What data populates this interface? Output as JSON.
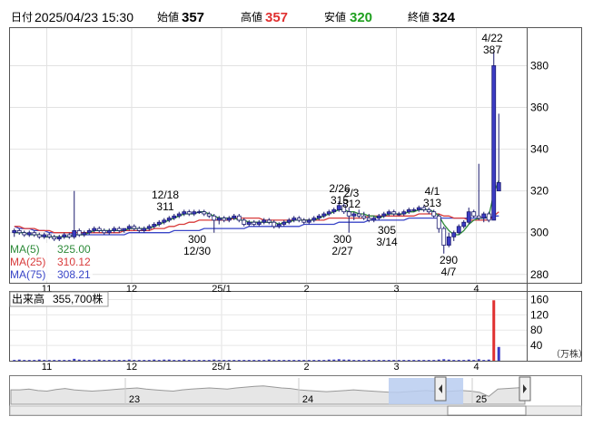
{
  "header": {
    "date_label": "日付",
    "date_value": "2025/04/23 15:30",
    "open_label": "始値",
    "open_value": "357",
    "high_label": "高値",
    "high_value": "357",
    "low_label": "安値",
    "low_value": "320",
    "close_label": "終値",
    "close_value": "324"
  },
  "volume_header": {
    "label": "出来高",
    "value": "355,700株"
  },
  "volume_unit": "（万株）",
  "colors": {
    "up_candle": "#3b3bc4",
    "down_candle": "#ffffff",
    "ma5": "#2e8b3a",
    "ma25": "#d83b3b",
    "ma75": "#3a46c8",
    "high_text": "#e03030",
    "low_text": "#20a020",
    "volume_bar": "#3b3bc4",
    "volume_spike": "#e03030",
    "navigator_highlight": "#b8cdf0"
  },
  "chart_data": [
    {
      "type": "candlestick",
      "title": "",
      "y_ticks": [
        280,
        300,
        320,
        340,
        360,
        380
      ],
      "ylim": [
        276,
        398
      ],
      "x_month_ticks": [
        "11",
        "12",
        "25/1",
        "2",
        "3",
        "4"
      ],
      "ma_legend": [
        {
          "name": "MA(5)",
          "value": "325.00"
        },
        {
          "name": "MA(25)",
          "value": "310.12"
        },
        {
          "name": "MA(75)",
          "value": "308.21"
        }
      ],
      "annotations": [
        {
          "date": "12/18",
          "value": "311",
          "kind": "high"
        },
        {
          "date": "12/30",
          "value": "300",
          "kind": "low"
        },
        {
          "date": "2/26",
          "value": "315",
          "kind": "high"
        },
        {
          "date": "2/3",
          "value": "312",
          "kind": "high"
        },
        {
          "date": "2/27",
          "value": "300",
          "kind": "low"
        },
        {
          "date": "3/14",
          "value": "305",
          "kind": "low"
        },
        {
          "date": "4/1",
          "value": "313",
          "kind": "high"
        },
        {
          "date": "4/7",
          "value": "290",
          "kind": "low"
        },
        {
          "date": "4/22",
          "value": "387",
          "kind": "high"
        }
      ],
      "candles": [
        [
          300,
          302,
          298,
          301
        ],
        [
          301,
          302,
          299,
          300
        ],
        [
          300,
          301,
          298,
          299
        ],
        [
          299,
          301,
          298,
          300
        ],
        [
          300,
          301,
          298,
          299
        ],
        [
          299,
          300,
          297,
          298
        ],
        [
          298,
          300,
          297,
          299
        ],
        [
          299,
          300,
          297,
          298
        ],
        [
          298,
          299,
          296,
          297
        ],
        [
          297,
          299,
          296,
          298
        ],
        [
          298,
          300,
          297,
          299
        ],
        [
          299,
          300,
          297,
          298
        ],
        [
          298,
          320,
          297,
          301
        ],
        [
          301,
          302,
          298,
          299
        ],
        [
          299,
          301,
          298,
          300
        ],
        [
          300,
          302,
          299,
          301
        ],
        [
          301,
          303,
          300,
          302
        ],
        [
          302,
          303,
          300,
          301
        ],
        [
          301,
          302,
          299,
          300
        ],
        [
          300,
          302,
          299,
          301
        ],
        [
          301,
          303,
          300,
          302
        ],
        [
          302,
          303,
          300,
          301
        ],
        [
          301,
          302,
          300,
          302
        ],
        [
          302,
          304,
          301,
          303
        ],
        [
          303,
          304,
          301,
          302
        ],
        [
          302,
          303,
          300,
          301
        ],
        [
          301,
          303,
          300,
          302
        ],
        [
          302,
          304,
          301,
          303
        ],
        [
          303,
          305,
          302,
          304
        ],
        [
          304,
          306,
          303,
          305
        ],
        [
          305,
          307,
          304,
          306
        ],
        [
          306,
          308,
          305,
          307
        ],
        [
          307,
          309,
          306,
          308
        ],
        [
          308,
          310,
          307,
          309
        ],
        [
          309,
          311,
          308,
          310
        ],
        [
          310,
          311,
          308,
          309
        ],
        [
          309,
          311,
          308,
          310
        ],
        [
          310,
          311,
          309,
          310
        ],
        [
          310,
          311,
          308,
          309
        ],
        [
          309,
          310,
          307,
          308
        ],
        [
          308,
          309,
          300,
          306
        ],
        [
          306,
          308,
          304,
          307
        ],
        [
          307,
          308,
          305,
          306
        ],
        [
          306,
          308,
          305,
          307
        ],
        [
          307,
          309,
          306,
          308
        ],
        [
          308,
          309,
          305,
          306
        ],
        [
          306,
          307,
          303,
          304
        ],
        [
          304,
          306,
          303,
          305
        ],
        [
          305,
          306,
          303,
          304
        ],
        [
          304,
          306,
          303,
          305
        ],
        [
          305,
          307,
          304,
          306
        ],
        [
          306,
          307,
          304,
          305
        ],
        [
          305,
          306,
          302,
          303
        ],
        [
          303,
          305,
          302,
          304
        ],
        [
          304,
          306,
          303,
          305
        ],
        [
          305,
          307,
          304,
          306
        ],
        [
          306,
          308,
          305,
          307
        ],
        [
          307,
          308,
          305,
          306
        ],
        [
          306,
          307,
          304,
          305
        ],
        [
          305,
          307,
          304,
          306
        ],
        [
          306,
          308,
          305,
          307
        ],
        [
          307,
          309,
          306,
          308
        ],
        [
          308,
          310,
          307,
          309
        ],
        [
          309,
          311,
          308,
          310
        ],
        [
          310,
          312,
          309,
          311
        ],
        [
          311,
          315,
          310,
          313
        ],
        [
          313,
          314,
          309,
          310
        ],
        [
          310,
          312,
          300,
          308
        ],
        [
          308,
          310,
          306,
          309
        ],
        [
          309,
          311,
          307,
          308
        ],
        [
          308,
          310,
          306,
          307
        ],
        [
          307,
          309,
          305,
          306
        ],
        [
          306,
          308,
          305,
          307
        ],
        [
          307,
          309,
          306,
          308
        ],
        [
          308,
          310,
          307,
          309
        ],
        [
          309,
          311,
          308,
          310
        ],
        [
          310,
          311,
          308,
          309
        ],
        [
          309,
          310,
          308,
          309
        ],
        [
          309,
          311,
          308,
          310
        ],
        [
          310,
          312,
          309,
          311
        ],
        [
          311,
          312,
          310,
          311
        ],
        [
          311,
          313,
          310,
          312
        ],
        [
          312,
          313,
          310,
          311
        ],
        [
          311,
          312,
          309,
          310
        ],
        [
          310,
          311,
          307,
          308
        ],
        [
          308,
          309,
          300,
          302
        ],
        [
          302,
          303,
          290,
          294
        ],
        [
          294,
          300,
          293,
          298
        ],
        [
          298,
          301,
          296,
          300
        ],
        [
          300,
          304,
          299,
          303
        ],
        [
          303,
          306,
          302,
          305
        ],
        [
          305,
          312,
          304,
          310
        ],
        [
          310,
          311,
          307,
          308
        ],
        [
          308,
          333,
          306,
          307
        ],
        [
          307,
          310,
          305,
          309
        ],
        [
          309,
          310,
          305,
          306
        ],
        [
          306,
          387,
          306,
          380
        ],
        [
          320,
          357,
          320,
          324
        ]
      ],
      "ma5": [
        300,
        300,
        300,
        299,
        299,
        299,
        298,
        298,
        298,
        298,
        298,
        298,
        299,
        299,
        299,
        300,
        301,
        301,
        301,
        301,
        301,
        301,
        301,
        302,
        302,
        302,
        302,
        302,
        303,
        304,
        305,
        306,
        307,
        308,
        309,
        309,
        309,
        310,
        310,
        309,
        308,
        307,
        307,
        307,
        307,
        306,
        306,
        305,
        305,
        305,
        305,
        305,
        305,
        304,
        305,
        305,
        306,
        306,
        306,
        306,
        306,
        307,
        308,
        309,
        310,
        311,
        311,
        310,
        310,
        309,
        309,
        308,
        308,
        307,
        308,
        309,
        309,
        309,
        309,
        310,
        310,
        311,
        311,
        311,
        310,
        308,
        304,
        301,
        299,
        299,
        301,
        304,
        306,
        307,
        307,
        308,
        319,
        325
      ],
      "ma25": [
        303,
        303,
        302,
        302,
        302,
        301,
        301,
        301,
        300,
        300,
        300,
        300,
        300,
        300,
        300,
        300,
        300,
        300,
        300,
        300,
        300,
        300,
        301,
        301,
        301,
        301,
        301,
        301,
        302,
        302,
        302,
        303,
        303,
        304,
        304,
        305,
        305,
        306,
        306,
        306,
        306,
        306,
        306,
        306,
        307,
        307,
        307,
        307,
        307,
        307,
        306,
        306,
        306,
        306,
        306,
        306,
        306,
        306,
        306,
        306,
        306,
        306,
        306,
        307,
        307,
        307,
        307,
        307,
        307,
        307,
        307,
        308,
        308,
        308,
        308,
        308,
        308,
        308,
        308,
        308,
        308,
        309,
        309,
        309,
        309,
        309,
        308,
        308,
        307,
        307,
        307,
        306,
        306,
        306,
        306,
        306,
        308,
        310
      ],
      "ma75": [
        303,
        302,
        302,
        302,
        301,
        301,
        301,
        300,
        300,
        300,
        300,
        300,
        299,
        299,
        299,
        299,
        299,
        299,
        299,
        299,
        299,
        299,
        299,
        300,
        300,
        300,
        300,
        300,
        300,
        300,
        300,
        300,
        301,
        301,
        301,
        301,
        301,
        301,
        302,
        302,
        302,
        302,
        302,
        302,
        302,
        302,
        302,
        303,
        303,
        303,
        303,
        303,
        303,
        303,
        303,
        303,
        303,
        303,
        304,
        304,
        304,
        304,
        304,
        304,
        304,
        305,
        305,
        305,
        305,
        305,
        305,
        306,
        306,
        306,
        306,
        306,
        306,
        306,
        306,
        307,
        307,
        307,
        307,
        307,
        307,
        307,
        307,
        307,
        307,
        307,
        307,
        307,
        307,
        307,
        307,
        307,
        308,
        308
      ]
    },
    {
      "type": "bar",
      "title": "",
      "y_ticks": [
        40,
        80,
        120,
        160
      ],
      "ylim": [
        0,
        180
      ],
      "unit": "万株",
      "values": [
        2,
        3,
        2,
        2,
        2,
        3,
        2,
        2,
        2,
        2,
        2,
        2,
        5,
        3,
        2,
        2,
        2,
        3,
        2,
        2,
        2,
        2,
        2,
        3,
        2,
        2,
        2,
        2,
        3,
        2,
        3,
        3,
        2,
        2,
        3,
        2,
        2,
        2,
        2,
        2,
        3,
        2,
        2,
        2,
        2,
        2,
        2,
        2,
        2,
        2,
        2,
        3,
        2,
        2,
        2,
        2,
        2,
        2,
        2,
        2,
        2,
        2,
        2,
        3,
        3,
        4,
        3,
        3,
        2,
        2,
        2,
        2,
        2,
        2,
        2,
        2,
        2,
        2,
        2,
        2,
        2,
        2,
        2,
        2,
        2,
        3,
        4,
        3,
        2,
        2,
        2,
        3,
        2,
        4,
        2,
        3,
        158,
        36
      ],
      "spike_indices": [
        96
      ]
    },
    {
      "type": "area",
      "title": "",
      "year_labels": [
        "23",
        "24",
        "25"
      ],
      "values": [
        0.55,
        0.55,
        0.58,
        0.52,
        0.5,
        0.56,
        0.6,
        0.55,
        0.52,
        0.5,
        0.52,
        0.55,
        0.58,
        0.6,
        0.62,
        0.58,
        0.55,
        0.52,
        0.5,
        0.55,
        0.58,
        0.6,
        0.62,
        0.6,
        0.58,
        0.62,
        0.65,
        0.68,
        0.7,
        0.66,
        0.62,
        0.6,
        0.55,
        0.52,
        0.5,
        0.48,
        0.5,
        0.52,
        0.55,
        0.52,
        0.5,
        0.48,
        0.46,
        0.45,
        0.48,
        0.5,
        0.52,
        0.5,
        0.48,
        0.5,
        0.52,
        0.5,
        0.45,
        0.3,
        0.58,
        0.6,
        0.62,
        0.64
      ],
      "highlight_range": [
        0.735,
        0.88
      ]
    }
  ]
}
